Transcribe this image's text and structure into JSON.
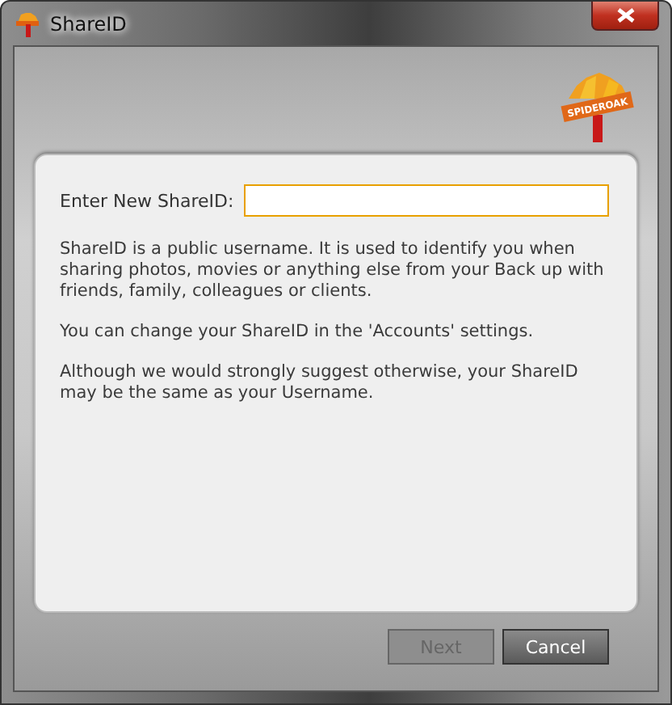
{
  "window": {
    "title": "ShareID"
  },
  "logo": {
    "text": "SPIDEROAK"
  },
  "form": {
    "label": "Enter New ShareID:",
    "focused": true
  },
  "paragraphs": [
    "ShareID is a public username. It is used to identify you when sharing photos, movies or anything else from your Back up with friends, family, colleagues or clients.",
    "You can change your ShareID in the 'Accounts' settings.",
    "Although we would strongly suggest otherwise, your ShareID may be the same as your Username."
  ],
  "buttons": [
    {
      "label": "Next",
      "disabled": true
    },
    {
      "label": "Cancel",
      "disabled": false
    }
  ]
}
